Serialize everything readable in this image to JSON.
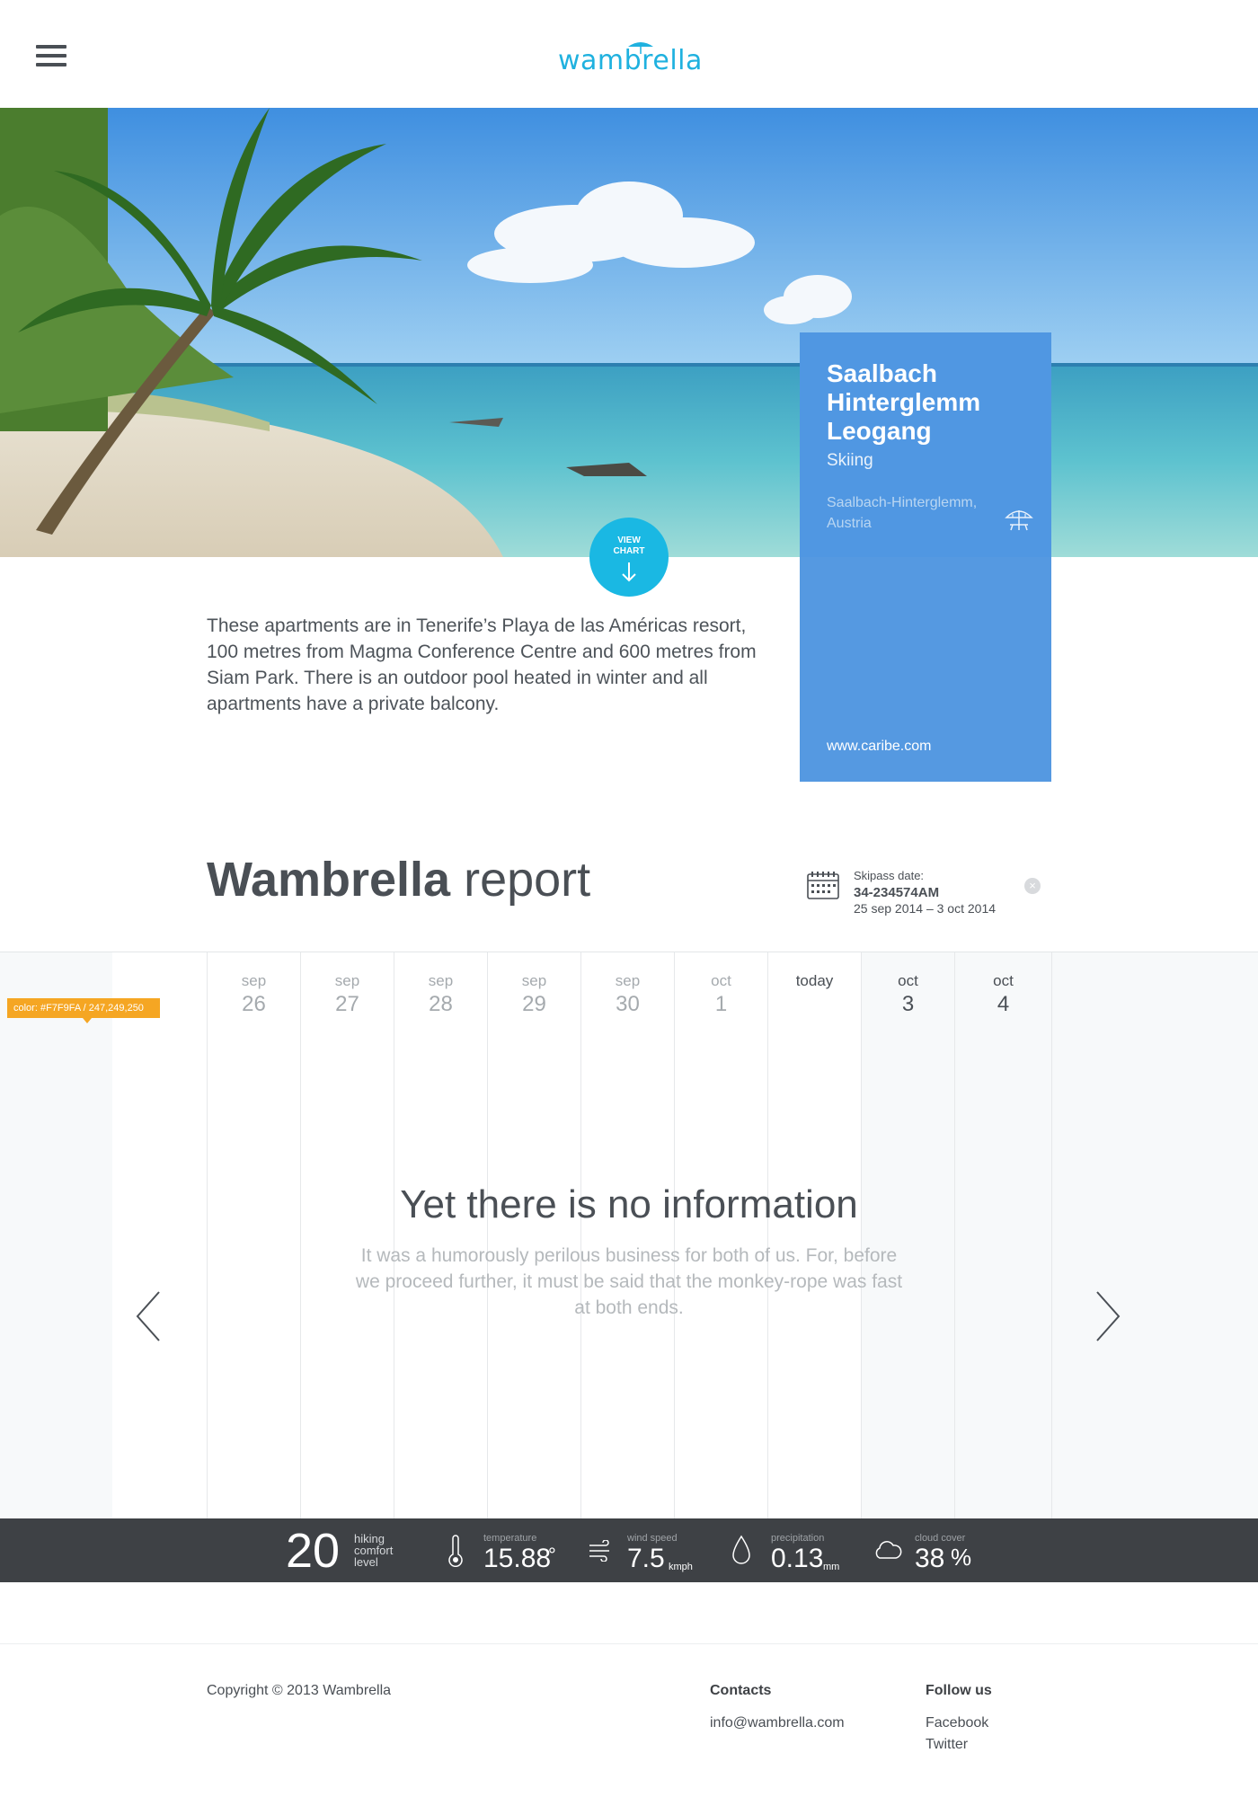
{
  "header": {
    "logo_text": "wambrella",
    "brand_color": "#1fb1df"
  },
  "hero": {
    "image": "tropical beach with palm tree, sea and clouds"
  },
  "card": {
    "title_line1": "Saalbach",
    "title_line2": "Hinterglemm",
    "title_line3": "Leogang",
    "subtitle": "Skiing",
    "location_line1": "Saalbach-Hinterglemm,",
    "location_line2": "Austria",
    "icon": "beach-umbrella-icon",
    "link": "www.caribe.com",
    "color": "#5599e1"
  },
  "view_chart": {
    "line1": "VIEW",
    "line2": "CHART",
    "color": "#1ab8e3"
  },
  "description": "These apartments are in Tenerife’s Playa de las Américas resort, 100 metres from Magma Conference Centre and 600 metres from Siam Park. There is an outdoor pool heated in winter and all apartments have a private balcony.",
  "report": {
    "title_bold": "Wambrella",
    "title_rest": " report",
    "skipass_label": "Skipass date:",
    "skipass_code": "34-234574AM",
    "skipass_range": "25 sep 2014 – 3 oct 2014"
  },
  "calendar": {
    "color_tag": "color: #F7F9FA / 247,249,250",
    "days": [
      {
        "month": "sep",
        "day": "26"
      },
      {
        "month": "sep",
        "day": "27"
      },
      {
        "month": "sep",
        "day": "28"
      },
      {
        "month": "sep",
        "day": "29"
      },
      {
        "month": "sep",
        "day": "30"
      },
      {
        "month": "oct",
        "day": "1"
      },
      {
        "month": "today",
        "day": ""
      },
      {
        "month": "oct",
        "day": "3"
      },
      {
        "month": "oct",
        "day": "4"
      }
    ],
    "empty_title": "Yet there is no information",
    "empty_text": "It was a humorously perilous business for both of us. For, before we proceed further, it must be said that the monkey-rope was fast at both ends."
  },
  "stats": {
    "comfort_value": "20",
    "comfort_label_1": "hiking",
    "comfort_label_2": "comfort",
    "comfort_label_3": "level",
    "temperature_label": "temperature",
    "temperature_value": "15.88",
    "temperature_unit": "°",
    "wind_label": "wind speed",
    "wind_value": "7.5",
    "wind_unit": "kmph",
    "precip_label": "precipitation",
    "precip_value": "0.13",
    "precip_unit": "mm",
    "cloud_label": "cloud cover",
    "cloud_value": "38",
    "cloud_unit": "%"
  },
  "footer": {
    "copyright": "Copyright © 2013 Wambrella",
    "contacts_heading": "Contacts",
    "contacts_email": "info@wambrella.com",
    "follow_heading": "Follow us",
    "facebook": "Facebook",
    "twitter": "Twitter"
  }
}
